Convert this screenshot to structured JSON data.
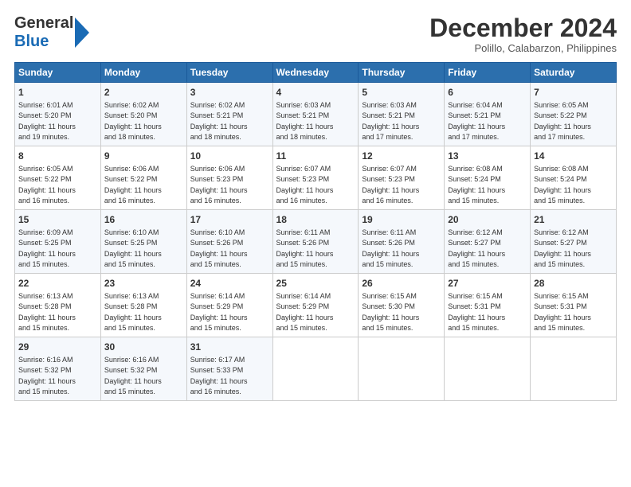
{
  "logo": {
    "line1": "General",
    "line2": "Blue"
  },
  "title": "December 2024",
  "subtitle": "Polillo, Calabarzon, Philippines",
  "days_header": [
    "Sunday",
    "Monday",
    "Tuesday",
    "Wednesday",
    "Thursday",
    "Friday",
    "Saturday"
  ],
  "weeks": [
    [
      {
        "day": "1",
        "info": "Sunrise: 6:01 AM\nSunset: 5:20 PM\nDaylight: 11 hours\nand 19 minutes."
      },
      {
        "day": "2",
        "info": "Sunrise: 6:02 AM\nSunset: 5:20 PM\nDaylight: 11 hours\nand 18 minutes."
      },
      {
        "day": "3",
        "info": "Sunrise: 6:02 AM\nSunset: 5:21 PM\nDaylight: 11 hours\nand 18 minutes."
      },
      {
        "day": "4",
        "info": "Sunrise: 6:03 AM\nSunset: 5:21 PM\nDaylight: 11 hours\nand 18 minutes."
      },
      {
        "day": "5",
        "info": "Sunrise: 6:03 AM\nSunset: 5:21 PM\nDaylight: 11 hours\nand 17 minutes."
      },
      {
        "day": "6",
        "info": "Sunrise: 6:04 AM\nSunset: 5:21 PM\nDaylight: 11 hours\nand 17 minutes."
      },
      {
        "day": "7",
        "info": "Sunrise: 6:05 AM\nSunset: 5:22 PM\nDaylight: 11 hours\nand 17 minutes."
      }
    ],
    [
      {
        "day": "8",
        "info": "Sunrise: 6:05 AM\nSunset: 5:22 PM\nDaylight: 11 hours\nand 16 minutes."
      },
      {
        "day": "9",
        "info": "Sunrise: 6:06 AM\nSunset: 5:22 PM\nDaylight: 11 hours\nand 16 minutes."
      },
      {
        "day": "10",
        "info": "Sunrise: 6:06 AM\nSunset: 5:23 PM\nDaylight: 11 hours\nand 16 minutes."
      },
      {
        "day": "11",
        "info": "Sunrise: 6:07 AM\nSunset: 5:23 PM\nDaylight: 11 hours\nand 16 minutes."
      },
      {
        "day": "12",
        "info": "Sunrise: 6:07 AM\nSunset: 5:23 PM\nDaylight: 11 hours\nand 16 minutes."
      },
      {
        "day": "13",
        "info": "Sunrise: 6:08 AM\nSunset: 5:24 PM\nDaylight: 11 hours\nand 15 minutes."
      },
      {
        "day": "14",
        "info": "Sunrise: 6:08 AM\nSunset: 5:24 PM\nDaylight: 11 hours\nand 15 minutes."
      }
    ],
    [
      {
        "day": "15",
        "info": "Sunrise: 6:09 AM\nSunset: 5:25 PM\nDaylight: 11 hours\nand 15 minutes."
      },
      {
        "day": "16",
        "info": "Sunrise: 6:10 AM\nSunset: 5:25 PM\nDaylight: 11 hours\nand 15 minutes."
      },
      {
        "day": "17",
        "info": "Sunrise: 6:10 AM\nSunset: 5:26 PM\nDaylight: 11 hours\nand 15 minutes."
      },
      {
        "day": "18",
        "info": "Sunrise: 6:11 AM\nSunset: 5:26 PM\nDaylight: 11 hours\nand 15 minutes."
      },
      {
        "day": "19",
        "info": "Sunrise: 6:11 AM\nSunset: 5:26 PM\nDaylight: 11 hours\nand 15 minutes."
      },
      {
        "day": "20",
        "info": "Sunrise: 6:12 AM\nSunset: 5:27 PM\nDaylight: 11 hours\nand 15 minutes."
      },
      {
        "day": "21",
        "info": "Sunrise: 6:12 AM\nSunset: 5:27 PM\nDaylight: 11 hours\nand 15 minutes."
      }
    ],
    [
      {
        "day": "22",
        "info": "Sunrise: 6:13 AM\nSunset: 5:28 PM\nDaylight: 11 hours\nand 15 minutes."
      },
      {
        "day": "23",
        "info": "Sunrise: 6:13 AM\nSunset: 5:28 PM\nDaylight: 11 hours\nand 15 minutes."
      },
      {
        "day": "24",
        "info": "Sunrise: 6:14 AM\nSunset: 5:29 PM\nDaylight: 11 hours\nand 15 minutes."
      },
      {
        "day": "25",
        "info": "Sunrise: 6:14 AM\nSunset: 5:29 PM\nDaylight: 11 hours\nand 15 minutes."
      },
      {
        "day": "26",
        "info": "Sunrise: 6:15 AM\nSunset: 5:30 PM\nDaylight: 11 hours\nand 15 minutes."
      },
      {
        "day": "27",
        "info": "Sunrise: 6:15 AM\nSunset: 5:31 PM\nDaylight: 11 hours\nand 15 minutes."
      },
      {
        "day": "28",
        "info": "Sunrise: 6:15 AM\nSunset: 5:31 PM\nDaylight: 11 hours\nand 15 minutes."
      }
    ],
    [
      {
        "day": "29",
        "info": "Sunrise: 6:16 AM\nSunset: 5:32 PM\nDaylight: 11 hours\nand 15 minutes."
      },
      {
        "day": "30",
        "info": "Sunrise: 6:16 AM\nSunset: 5:32 PM\nDaylight: 11 hours\nand 15 minutes."
      },
      {
        "day": "31",
        "info": "Sunrise: 6:17 AM\nSunset: 5:33 PM\nDaylight: 11 hours\nand 16 minutes."
      },
      {
        "day": "",
        "info": ""
      },
      {
        "day": "",
        "info": ""
      },
      {
        "day": "",
        "info": ""
      },
      {
        "day": "",
        "info": ""
      }
    ]
  ]
}
